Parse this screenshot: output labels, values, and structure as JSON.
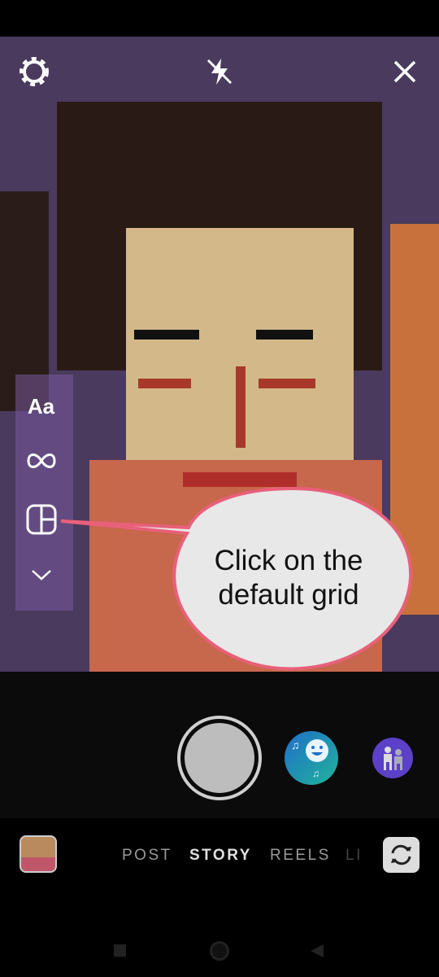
{
  "top_bar": {
    "settings_icon": "gear-icon",
    "flash_icon": "flash-off-icon",
    "close_icon": "close-icon"
  },
  "side_tools": [
    {
      "name": "text-tool",
      "label": "Aa"
    },
    {
      "name": "boomerang-tool",
      "icon": "infinity-icon"
    },
    {
      "name": "layout-tool",
      "icon": "layout-grid-icon"
    },
    {
      "name": "more-tools",
      "icon": "chevron-down-icon"
    }
  ],
  "callout": {
    "text_line1": "Click on the",
    "text_line2": "default grid",
    "border_color": "#e8607a",
    "fill_color": "#e8e8e8"
  },
  "effects": [
    {
      "name": "karaoke-effect",
      "icon": "music-smile-icon",
      "colors": [
        "#1f6fc9",
        "#22b39a"
      ]
    },
    {
      "name": "dance-effect",
      "icon": "dancers-icon",
      "color": "#5b40c8"
    }
  ],
  "modes": {
    "items": [
      "POST",
      "STORY",
      "REELS",
      "LI"
    ],
    "selected": "STORY"
  },
  "bottom": {
    "gallery_icon": "gallery-thumbnail",
    "flip_icon": "flip-camera-icon"
  },
  "nav": {
    "recents": "square-icon",
    "home": "circle-icon",
    "back": "triangle-back-icon"
  }
}
